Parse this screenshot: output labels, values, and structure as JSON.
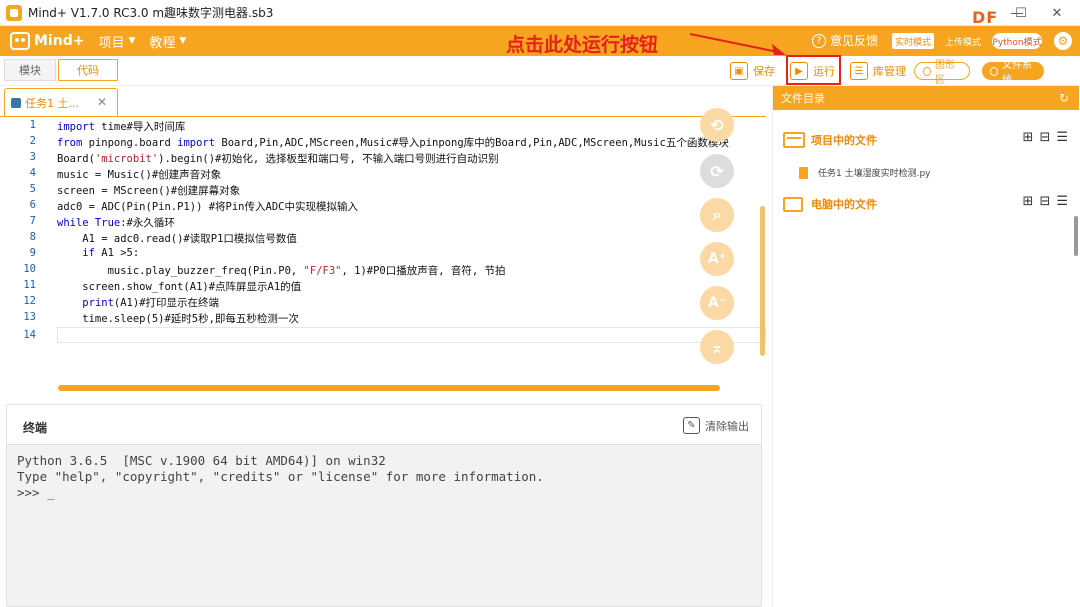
{
  "window": {
    "title": "Mind+ V1.7.0 RC3.0   m趣味数字测电器.sb3",
    "watermark": "DF"
  },
  "menubar": {
    "logo_text": "Mind+",
    "items": [
      {
        "label": "项目"
      },
      {
        "label": "教程"
      }
    ],
    "annotation": "点击此处运行按钮",
    "feedback": "意见反馈",
    "mode_realtime": "实时模式",
    "mode_upload": "上传模式",
    "mode_python": "Python模式"
  },
  "toolbar": {
    "tab_blocks": "模块",
    "tab_code": "代码",
    "save": "保存",
    "run": "运行",
    "library": "库管理",
    "graph": "图形区",
    "file_system": "文件系统"
  },
  "editor": {
    "tab_label": "任务1 土...",
    "lines": [
      {
        "n": "1"
      },
      {
        "n": "2"
      },
      {
        "n": "3"
      },
      {
        "n": "4"
      },
      {
        "n": "5"
      },
      {
        "n": "6"
      },
      {
        "n": "7"
      },
      {
        "n": "8"
      },
      {
        "n": "9"
      },
      {
        "n": "10"
      },
      {
        "n": "11"
      },
      {
        "n": "12"
      },
      {
        "n": "13"
      },
      {
        "n": "14"
      }
    ],
    "code": {
      "l1_kw": "import",
      "l1_rest": " time#导入时间库",
      "l2_kw1": "from",
      "l2_mid": " pinpong.board ",
      "l2_kw2": "import",
      "l2_rest": " Board,Pin,ADC,MScreen,Music#导入pinpong库中的Board,Pin,ADC,MScreen,Music五个函数模块",
      "l3_a": "Board(",
      "l3_str": "'microbit'",
      "l3_b": ").begin()#初始化, 选择板型和端口号, 不输入端口号则进行自动识别",
      "l4": "music = Music()#创建声音对象",
      "l5": "screen = MScreen()#创建屏幕对象",
      "l6": "adc0 = ADC(Pin(Pin.P1)) #将Pin传入ADC中实现模拟输入",
      "l7_kw": "while",
      "l7_kw2": " True",
      "l7_rest": ":#永久循环",
      "l8": "    A1 = adc0.read()#读取P1口模拟信号数值",
      "l9_ind": "    ",
      "l9_kw": "if",
      "l9_rest": " A1 >5:",
      "l10_a": "        music.play_buzzer_freq(Pin.P0, ",
      "l10_str": "\"F/F3\"",
      "l10_b": ", 1)#P0口播放声音, 音符, 节拍",
      "l11": "    screen.show_font(A1)#点阵屏显示A1的值",
      "l12_ind": "    ",
      "l12_kw": "print",
      "l12_rest": "(A1)#打印显示在终端",
      "l13": "    time.sleep(5)#延时5秒,即每五秒检测一次"
    }
  },
  "side_tools": [
    {
      "icon": "undo-icon",
      "glyph": "⟲"
    },
    {
      "icon": "redo-icon",
      "glyph": "⟳"
    },
    {
      "icon": "search-icon",
      "glyph": "⌕"
    },
    {
      "icon": "font-increase-icon",
      "glyph": "A⁺"
    },
    {
      "icon": "font-decrease-icon",
      "glyph": "A⁻"
    },
    {
      "icon": "scroll-top-icon",
      "glyph": "⌅"
    }
  ],
  "terminal": {
    "title": "终端",
    "clear": "清除输出",
    "output": "Python 3.6.5  [MSC v.1900 64 bit AMD64)] on win32\nType \"help\", \"copyright\", \"credits\" or \"license\" for more information.\n>>> _"
  },
  "right_panel": {
    "title": "文件目录",
    "project_files": "项目中的文件",
    "project_file_name": "任务1 土壤湿度实时检测.py",
    "computer_files": "电脑中的文件"
  },
  "colors": {
    "accent": "#f7a520",
    "annotation": "#e8201c"
  }
}
